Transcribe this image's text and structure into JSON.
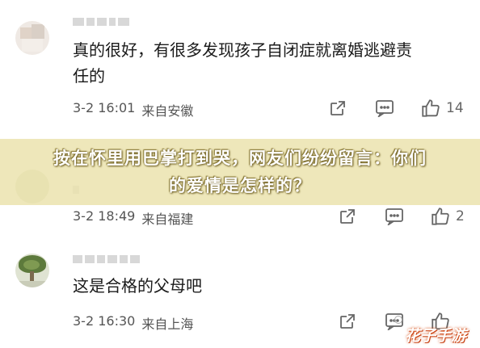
{
  "comments": [
    {
      "text_line1": "真的很好，有很多发现孩子自闭症就离婚逃避责",
      "text_line2": "任的",
      "date": "3-2 16:01",
      "location": "来自安徽",
      "likes": "14"
    },
    {
      "date": "3-2 18:49",
      "location": "来自福建",
      "likes": "2"
    },
    {
      "text_line1": "这是合格的父母吧",
      "date": "3-2 16:30",
      "location": "来自上海",
      "likes": ""
    }
  ],
  "banner": {
    "line1": "按在怀里用巴掌打到哭，网友们纷纷留言：你们",
    "line2": "的爱情是怎样的？"
  },
  "watermark": "花子手游",
  "icons": [
    "share-icon",
    "comment-icon",
    "like-icon"
  ],
  "colors": {
    "banner_bg": "#ece4b0",
    "text": "#1a1a1a",
    "meta": "#555555",
    "icon": "#666666",
    "watermark": "#d6541c"
  }
}
